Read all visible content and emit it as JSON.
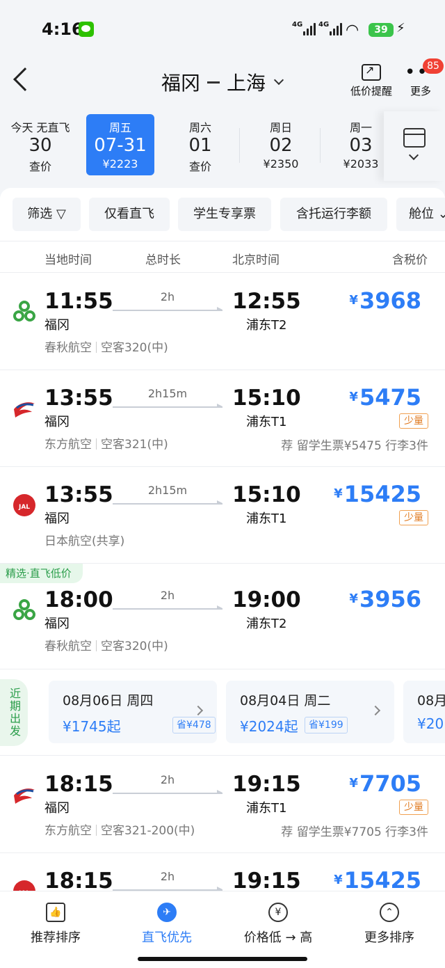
{
  "status_bar": {
    "time": "4:16",
    "network_1": "4G",
    "network_2": "4G",
    "battery": "39"
  },
  "header": {
    "origin": "福冈",
    "destination": "上海",
    "alert_label": "低价提醒",
    "more_label": "更多",
    "more_badge": "85"
  },
  "dates": [
    {
      "top": "今天 无直飞",
      "date": "30",
      "price": "查价"
    },
    {
      "top": "周五",
      "date": "07-31",
      "price": "¥2223",
      "active": true
    },
    {
      "top": "周六",
      "date": "01",
      "price": "查价"
    },
    {
      "top": "周日",
      "date": "02",
      "price": "¥2350"
    },
    {
      "top": "周一",
      "date": "03",
      "price": "¥2033"
    }
  ],
  "filters": [
    "筛选",
    "仅看直飞",
    "学生专享票",
    "含托运行李额",
    "舱位"
  ],
  "columns": {
    "local": "当地时间",
    "duration": "总时长",
    "beijing": "北京时间",
    "price": "含税价"
  },
  "flights": [
    {
      "dep": "11:55",
      "dport": "福冈",
      "dur": "2h",
      "arr": "12:55",
      "aport": "浦东T2",
      "price": "3968",
      "airline": "春秋航空",
      "aircraft": "空客320(中)",
      "logo": "spring-airlines-logo"
    },
    {
      "dep": "13:55",
      "dport": "福冈",
      "dur": "2h15m",
      "arr": "15:10",
      "aport": "浦东T1",
      "price": "5475",
      "tag": "少量",
      "airline": "东方航空",
      "aircraft": "空客321(中)",
      "note": "荐 留学生票¥5475 行李3件",
      "logo": "china-eastern-logo"
    },
    {
      "dep": "13:55",
      "dport": "福冈",
      "dur": "2h15m",
      "arr": "15:10",
      "aport": "浦东T1",
      "price": "15425",
      "tag": "少量",
      "airline": "日本航空(共享)",
      "logo": "jal-logo"
    },
    {
      "dep": "18:00",
      "dport": "福冈",
      "dur": "2h",
      "arr": "19:00",
      "aport": "浦东T2",
      "price": "3956",
      "airline": "春秋航空",
      "aircraft": "空客320(中)",
      "select_tag": "精选·直飞低价",
      "logo": "spring-airlines-logo"
    },
    {
      "dep": "18:15",
      "dport": "福冈",
      "dur": "2h",
      "arr": "19:15",
      "aport": "浦东T1",
      "price": "7705",
      "tag": "少量",
      "airline": "东方航空",
      "aircraft": "空客321-200(中)",
      "note": "荐 留学生票¥7705 行李3件",
      "logo": "china-eastern-logo"
    },
    {
      "dep": "18:15",
      "dur": "2h",
      "arr": "19:15",
      "price": "15425",
      "logo": "jal-logo"
    }
  ],
  "recent": {
    "label": "近期出发",
    "cards": [
      {
        "date": "08月06日 周四",
        "price": "¥1745起",
        "save": "省¥478"
      },
      {
        "date": "08月04日 周二",
        "price": "¥2024起",
        "save": "省¥199"
      },
      {
        "date": "08月",
        "price": "¥20"
      }
    ]
  },
  "tabs": [
    {
      "label": "推荐排序",
      "icon": "thumbs-up-icon"
    },
    {
      "label": "直飞优先",
      "icon": "plane-icon",
      "active": true
    },
    {
      "label": "价格低 → 高",
      "icon": "yen-icon"
    },
    {
      "label": "更多排序",
      "icon": "chevron-up-icon"
    }
  ],
  "colors": {
    "accent": "#2d7df6",
    "green": "#2a9d4a",
    "orange": "#e07b22"
  }
}
